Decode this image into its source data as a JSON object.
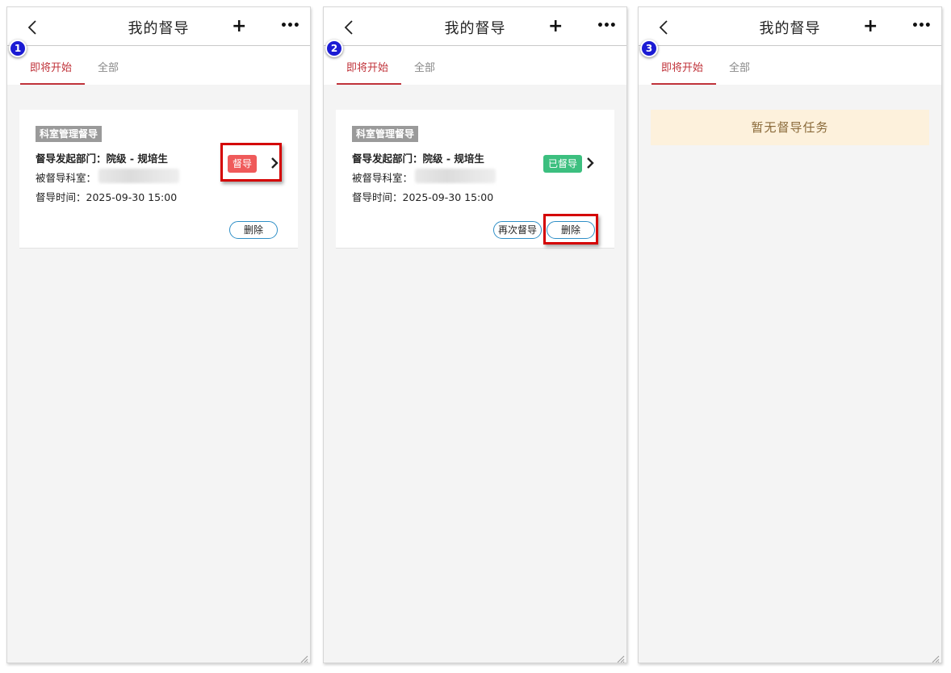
{
  "panels": [
    {
      "step": "1",
      "header": {
        "title": "我的督导"
      },
      "tabs": {
        "active": "即将开始",
        "inactive": "全部"
      },
      "card": {
        "badge": "科室管理督导",
        "initiator": "督导发起部门：院级 - 规培生",
        "dept_label": "被督导科室：",
        "time": "督导时间：2025-09-30 15:00",
        "status": "督导",
        "status_color": "#ef5a5a",
        "actions": [
          "删除"
        ]
      }
    },
    {
      "step": "2",
      "header": {
        "title": "我的督导"
      },
      "tabs": {
        "active": "即将开始",
        "inactive": "全部"
      },
      "card": {
        "badge": "科室管理督导",
        "initiator": "督导发起部门：院级 - 规培生",
        "dept_label": "被督导科室：",
        "time": "督导时间：2025-09-30 15:00",
        "status": "已督导",
        "status_color": "#3cbf7f",
        "actions": [
          "再次督导",
          "删除"
        ]
      }
    },
    {
      "step": "3",
      "header": {
        "title": "我的督导"
      },
      "tabs": {
        "active": "即将开始",
        "inactive": "全部"
      },
      "empty": "暂无督导任务"
    }
  ],
  "colors": {
    "accent": "#c0333a",
    "highlight": "#d40000",
    "step_badge": "#1b1bd4"
  },
  "icons": [
    "back-icon",
    "plus-icon",
    "more-icon",
    "chevron-right-icon",
    "resize-grip-icon"
  ]
}
